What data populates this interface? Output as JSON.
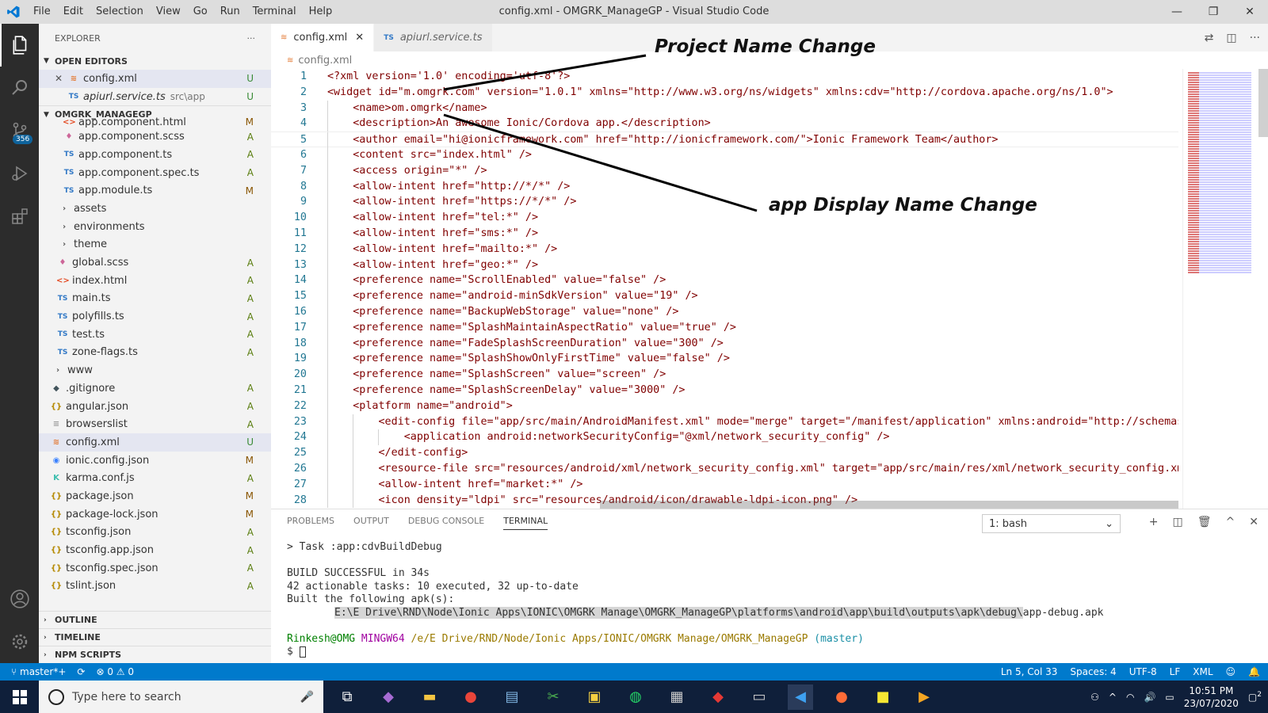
{
  "titlebar": {
    "menu": [
      "File",
      "Edit",
      "Selection",
      "View",
      "Go",
      "Run",
      "Terminal",
      "Help"
    ],
    "title": "config.xml - OMGRK_ManageGP - Visual Studio Code",
    "controls": [
      "—",
      "❐",
      "✕"
    ]
  },
  "activity": {
    "scm_badge": "356"
  },
  "explorer": {
    "header": "EXPLORER",
    "more": "···",
    "open_editors_label": "OPEN EDITORS",
    "open_editors": [
      {
        "close": "✕",
        "icon": "≋",
        "name": "config.xml",
        "extra": "",
        "status": "U"
      },
      {
        "close": "",
        "icon": "TS",
        "name": "apiurl.service.ts",
        "extra": "src\\app",
        "status": "U"
      }
    ],
    "project_label": "OMGRK_MANAGEGP",
    "files": [
      {
        "icon": "<>",
        "name": "app.component.html",
        "status": "M"
      },
      {
        "icon": "♦",
        "name": "app.component.scss",
        "status": "A"
      },
      {
        "icon": "TS",
        "name": "app.component.ts",
        "status": "A"
      },
      {
        "icon": "TS",
        "name": "app.component.spec.ts",
        "status": "A"
      },
      {
        "icon": "TS",
        "name": "app.module.ts",
        "status": "M"
      },
      {
        "icon": "›",
        "name": "assets",
        "status": ""
      },
      {
        "icon": "›",
        "name": "environments",
        "status": ""
      },
      {
        "icon": "›",
        "name": "theme",
        "status": ""
      },
      {
        "icon": "♦",
        "name": "global.scss",
        "status": "A"
      },
      {
        "icon": "<>",
        "name": "index.html",
        "status": "A"
      },
      {
        "icon": "TS",
        "name": "main.ts",
        "status": "A"
      },
      {
        "icon": "TS",
        "name": "polyfills.ts",
        "status": "A"
      },
      {
        "icon": "TS",
        "name": "test.ts",
        "status": "A"
      },
      {
        "icon": "TS",
        "name": "zone-flags.ts",
        "status": "A"
      },
      {
        "icon": "›",
        "name": "www",
        "status": ""
      },
      {
        "icon": "◆",
        "name": ".gitignore",
        "status": "A"
      },
      {
        "icon": "{}",
        "name": "angular.json",
        "status": "A"
      },
      {
        "icon": "≡",
        "name": "browserslist",
        "status": "A"
      },
      {
        "icon": "≋",
        "name": "config.xml",
        "status": "U"
      },
      {
        "icon": "◉",
        "name": "ionic.config.json",
        "status": "M"
      },
      {
        "icon": "K",
        "name": "karma.conf.js",
        "status": "A"
      },
      {
        "icon": "{}",
        "name": "package.json",
        "status": "M"
      },
      {
        "icon": "{}",
        "name": "package-lock.json",
        "status": "M"
      },
      {
        "icon": "{}",
        "name": "tsconfig.json",
        "status": "A"
      },
      {
        "icon": "{}",
        "name": "tsconfig.app.json",
        "status": "A"
      },
      {
        "icon": "{}",
        "name": "tsconfig.spec.json",
        "status": "A"
      },
      {
        "icon": "{}",
        "name": "tslint.json",
        "status": "A"
      }
    ],
    "bottom_sections": [
      "OUTLINE",
      "TIMELINE",
      "NPM SCRIPTS"
    ]
  },
  "tabs": [
    {
      "icon": "≋",
      "name": "config.xml",
      "close": "✕"
    },
    {
      "icon": "TS",
      "name": "apiurl.service.ts"
    }
  ],
  "breadcrumb": {
    "icon": "≋",
    "file": "config.xml"
  },
  "code": {
    "lines": [
      "<?xml version='1.0' encoding='utf-8'?>",
      "<widget id=\"m.omgrk.com\" version=\"1.0.1\" xmlns=\"http://www.w3.org/ns/widgets\" xmlns:cdv=\"http://cordova.apache.org/ns/1.0\">",
      "    <name>om.omgrk</name>",
      "    <description>An awesome Ionic/Cordova app.</description>",
      "    <author email=\"hi@ionicframework.com\" href=\"http://ionicframework.com/\">Ionic Framework Team</author>",
      "    <content src=\"index.html\" />",
      "    <access origin=\"*\" />",
      "    <allow-intent href=\"http://*/*\" />",
      "    <allow-intent href=\"https://*/*\" />",
      "    <allow-intent href=\"tel:*\" />",
      "    <allow-intent href=\"sms:*\" />",
      "    <allow-intent href=\"mailto:*\" />",
      "    <allow-intent href=\"geo:*\" />",
      "    <preference name=\"ScrollEnabled\" value=\"false\" />",
      "    <preference name=\"android-minSdkVersion\" value=\"19\" />",
      "    <preference name=\"BackupWebStorage\" value=\"none\" />",
      "    <preference name=\"SplashMaintainAspectRatio\" value=\"true\" />",
      "    <preference name=\"FadeSplashScreenDuration\" value=\"300\" />",
      "    <preference name=\"SplashShowOnlyFirstTime\" value=\"false\" />",
      "    <preference name=\"SplashScreen\" value=\"screen\" />",
      "    <preference name=\"SplashScreenDelay\" value=\"3000\" />",
      "    <platform name=\"android\">",
      "        <edit-config file=\"app/src/main/AndroidManifest.xml\" mode=\"merge\" target=\"/manifest/application\" xmlns:android=\"http://schemas",
      "            <application android:networkSecurityConfig=\"@xml/network_security_config\" />",
      "        </edit-config>",
      "        <resource-file src=\"resources/android/xml/network_security_config.xml\" target=\"app/src/main/res/xml/network_security_config.xm",
      "        <allow-intent href=\"market:*\" />",
      "        <icon density=\"ldpi\" src=\"resources/android/icon/drawable-ldpi-icon.png\" />"
    ]
  },
  "annotations": {
    "project": "Project Name Change",
    "display": "app Display Name Change"
  },
  "panel": {
    "tabs": [
      "PROBLEMS",
      "OUTPUT",
      "DEBUG CONSOLE",
      "TERMINAL"
    ],
    "select": "1: bash",
    "actions": [
      "+",
      "◫",
      "🗑",
      "^",
      "✕"
    ],
    "term": {
      "l1": "> Task :app:cdvBuildDebug",
      "l2": "BUILD SUCCESSFUL in 34s",
      "l3": "42 actionable tasks: 10 executed, 32 up-to-date",
      "l4": "Built the following apk(s):",
      "path": "E:\\E Drive\\RND\\Node\\Ionic Apps\\IONIC\\OMGRK Manage\\OMGRK_ManageGP\\platforms\\android\\app\\build\\outputs\\apk\\debug\\",
      "apk": "app-debug.apk",
      "user": "Rinkesh@OMG",
      "env": "MINGW64",
      "cwd": "/e/E Drive/RND/Node/Ionic Apps/IONIC/OMGRK Manage/OMGRK_ManageGP",
      "branch": "(master)",
      "prompt": "$"
    }
  },
  "statusbar": {
    "branch": "⑂ master*+",
    "sync": "⟳",
    "problems": "⊗ 0 ⚠ 0",
    "position": "Ln 5, Col 33",
    "spaces": "Spaces: 4",
    "encoding": "UTF-8",
    "eol": "LF",
    "lang": "XML"
  },
  "taskbar": {
    "search_placeholder": "Type here to search",
    "time": "10:51 PM",
    "date": "23/07/2020",
    "notif": "2"
  }
}
